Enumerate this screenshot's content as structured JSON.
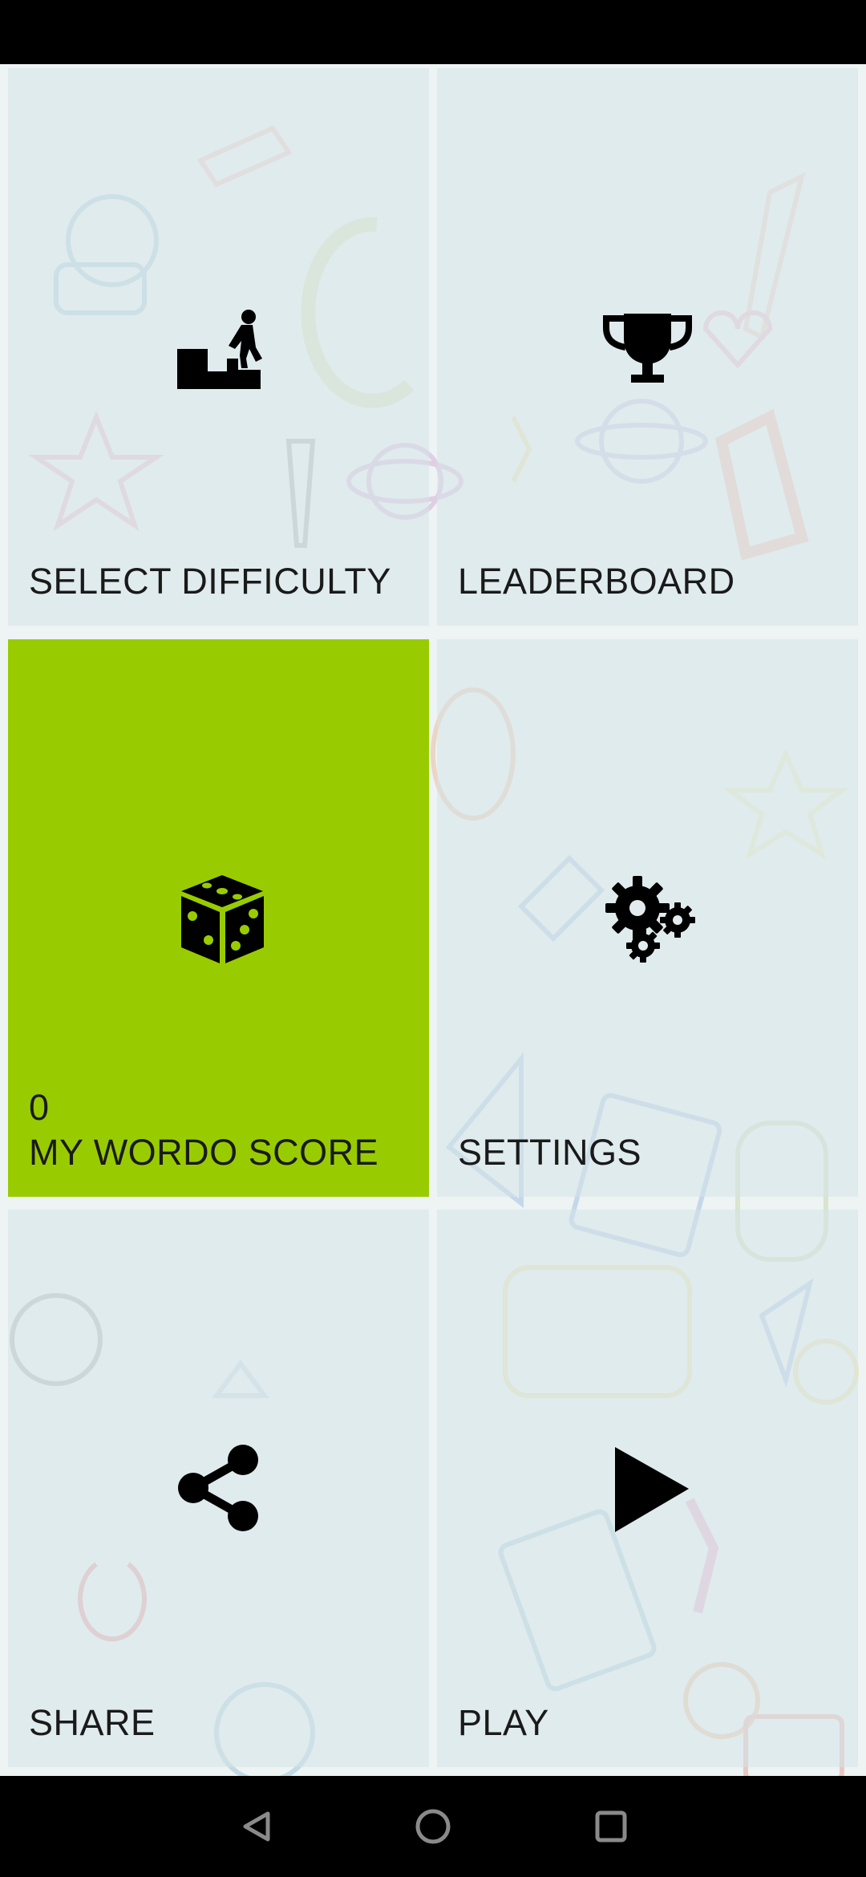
{
  "menu": {
    "select_difficulty": {
      "label": "SELECT DIFFICULTY",
      "icon": "stairs-climber-icon"
    },
    "leaderboard": {
      "label": "LEADERBOARD",
      "icon": "trophy-icon"
    },
    "my_score": {
      "label": "MY WORDO SCORE",
      "value": "0",
      "icon": "dice-icon",
      "color": "#99cc00"
    },
    "settings": {
      "label": "SETTINGS",
      "icon": "gears-icon"
    },
    "share": {
      "label": "SHARE",
      "icon": "share-icon"
    },
    "play": {
      "label": "PLAY",
      "icon": "play-icon"
    }
  },
  "navbar": {
    "back_icon": "back-triangle-icon",
    "home_icon": "home-circle-icon",
    "recents_icon": "recents-square-icon"
  }
}
